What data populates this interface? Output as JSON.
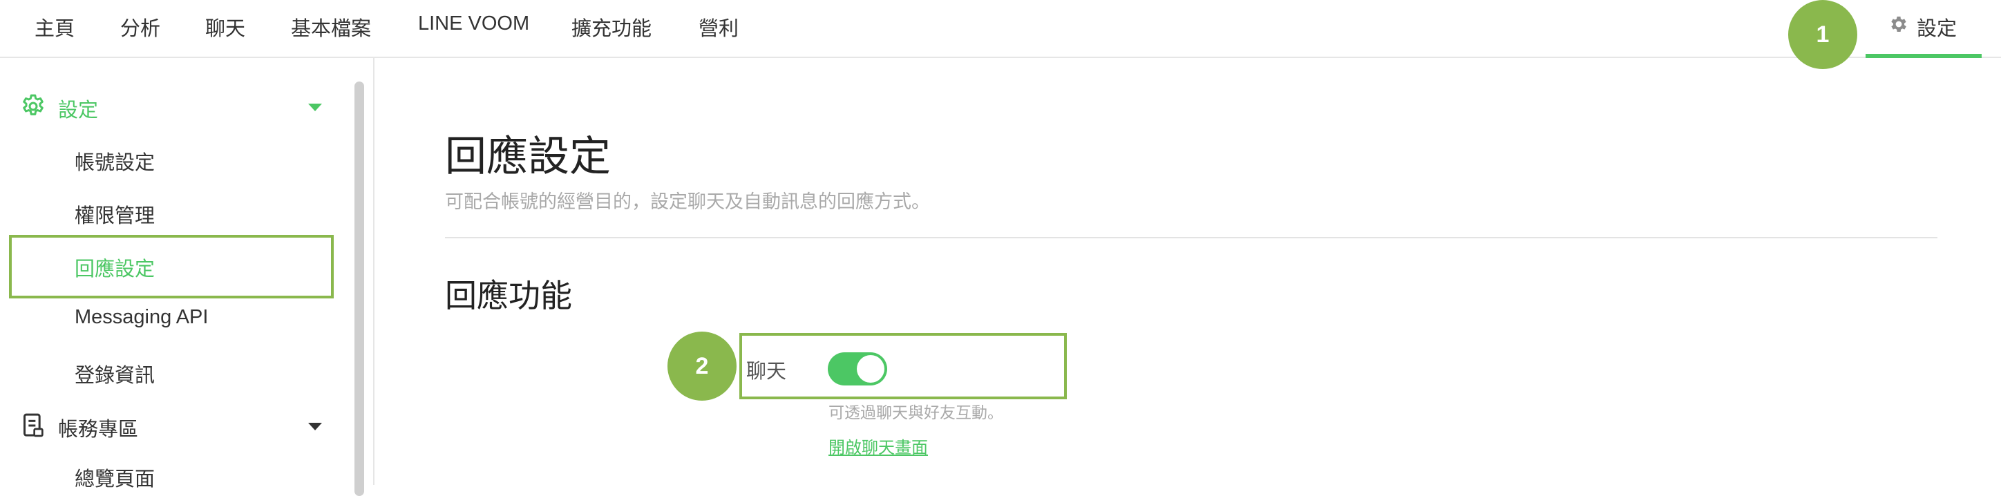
{
  "nav": {
    "items": [
      "主頁",
      "分析",
      "聊天",
      "基本檔案",
      "LINE VOOM",
      "擴充功能",
      "營利"
    ],
    "settings_label": "設定"
  },
  "badges": [
    "1",
    "2"
  ],
  "sidebar": {
    "settings_section": "設定",
    "settings_items": [
      "帳號設定",
      "權限管理",
      "回應設定",
      "Messaging API",
      "登錄資訊"
    ],
    "billing_section": "帳務專區",
    "billing_items": [
      "總覽頁面"
    ],
    "active_item": "回應設定"
  },
  "main": {
    "title": "回應設定",
    "subtitle": "可配合帳號的經營目的，設定聊天及自動訊息的回應方式。",
    "section_title": "回應功能",
    "chat": {
      "label": "聊天",
      "enabled": true,
      "hint": "可透過聊天與好友互動。",
      "link": "開啟聊天畫面"
    }
  },
  "colors": {
    "accent": "#4cc764",
    "highlight": "#8ab84d"
  },
  "icons": [
    "gear-icon",
    "caret-down-icon",
    "document-icon"
  ]
}
